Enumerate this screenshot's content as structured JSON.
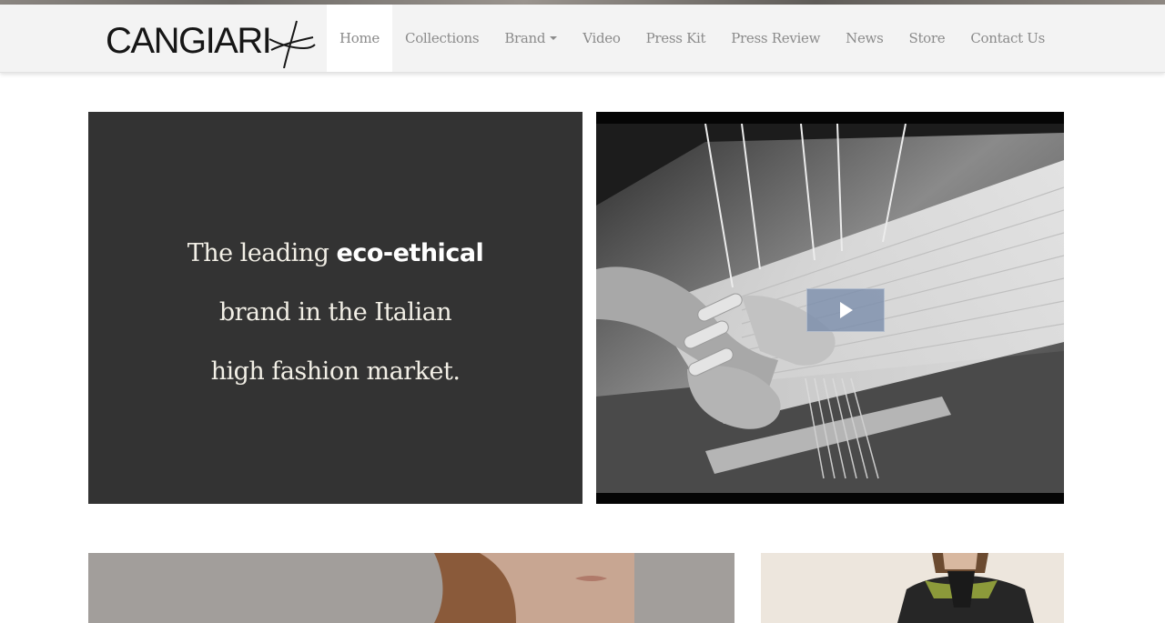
{
  "brand": {
    "logo_text": "CANGIARI",
    "logo_icon": "scissor-cross-mark"
  },
  "nav": {
    "items": [
      {
        "label": "Home",
        "active": true
      },
      {
        "label": "Collections"
      },
      {
        "label": "Brand",
        "has_dropdown": true
      },
      {
        "label": "Video"
      },
      {
        "label": "Press Kit"
      },
      {
        "label": "Press Review"
      },
      {
        "label": "News"
      },
      {
        "label": "Store"
      },
      {
        "label": "Contact Us"
      }
    ]
  },
  "hero": {
    "line1_pre": "The leading ",
    "line1_strong": "eco-ethical",
    "line2": "brand in the Italian",
    "line3": "high fashion market."
  },
  "video": {
    "play_icon": "play-icon"
  },
  "colors": {
    "nav_background": "#f3f3f3",
    "hero_panel": "#333333",
    "hero_text": "#f2efe6",
    "play_button": "#788caa"
  }
}
